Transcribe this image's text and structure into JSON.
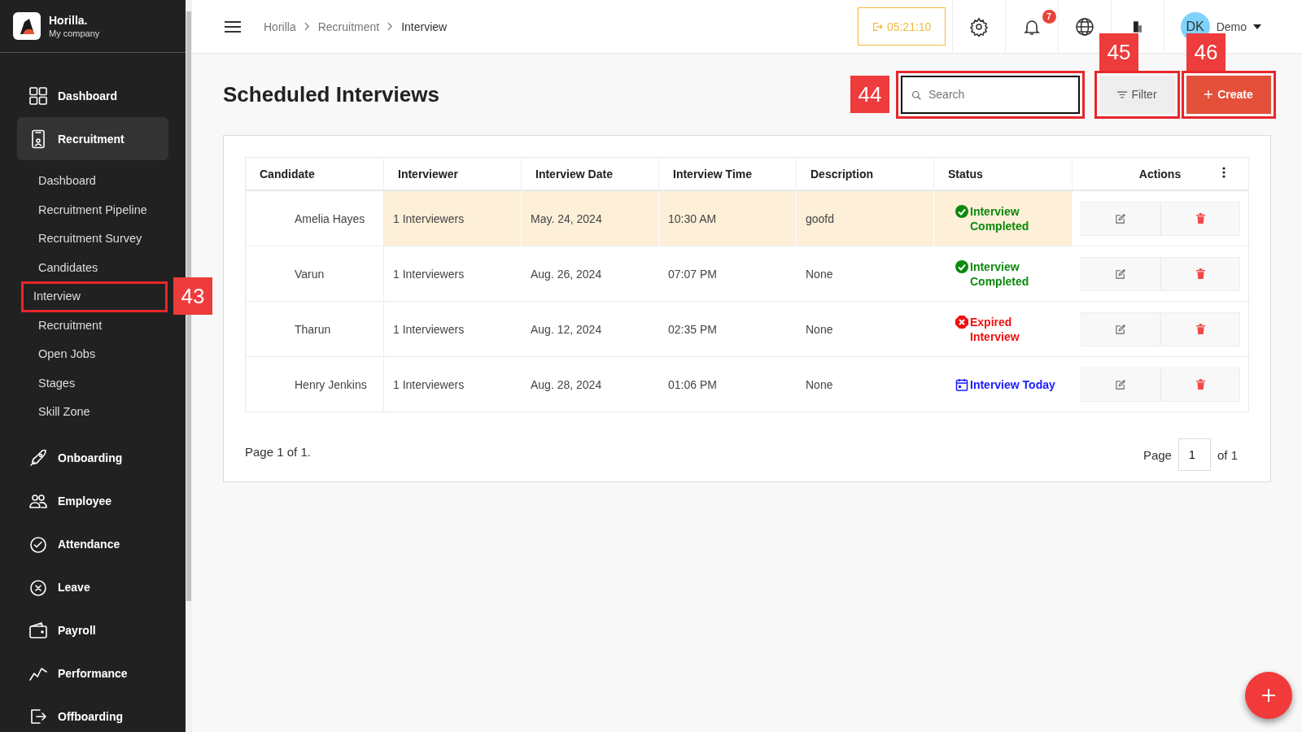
{
  "brand": {
    "name": "Horilla.",
    "company": "My company"
  },
  "sidebar": {
    "items": [
      {
        "label": "Dashboard",
        "selected": false
      },
      {
        "label": "Recruitment",
        "selected": true,
        "children": [
          {
            "label": "Dashboard"
          },
          {
            "label": "Recruitment Pipeline"
          },
          {
            "label": "Recruitment Survey"
          },
          {
            "label": "Candidates"
          },
          {
            "label": "Interview",
            "annotation": "43"
          },
          {
            "label": "Recruitment"
          },
          {
            "label": "Open Jobs"
          },
          {
            "label": "Stages"
          },
          {
            "label": "Skill Zone"
          }
        ]
      },
      {
        "label": "Onboarding",
        "selected": false
      },
      {
        "label": "Employee",
        "selected": false
      },
      {
        "label": "Attendance",
        "selected": false
      },
      {
        "label": "Leave",
        "selected": false
      },
      {
        "label": "Payroll",
        "selected": false
      },
      {
        "label": "Performance",
        "selected": false
      },
      {
        "label": "Offboarding",
        "selected": false
      }
    ]
  },
  "topbar": {
    "breadcrumbs": [
      "Horilla",
      "Recruitment",
      "Interview"
    ],
    "timer": "05:21:10",
    "notification_count": "7",
    "user": {
      "initials": "DK",
      "name": "Demo"
    }
  },
  "page": {
    "title": "Scheduled Interviews",
    "search": {
      "placeholder": "Search",
      "annotation": "44"
    },
    "filter_button": {
      "label": "Filter",
      "annotation": "45"
    },
    "create_button": {
      "label": "Create",
      "annotation": "46"
    }
  },
  "table": {
    "columns": [
      "Candidate",
      "Interviewer",
      "Interview Date",
      "Interview Time",
      "Description",
      "Status",
      "Actions"
    ],
    "rows": [
      {
        "candidate": "Amelia Hayes",
        "interviewer": "1 Interviewers",
        "date": "May. 24, 2024",
        "time": "10:30 AM",
        "description": "goofd",
        "status": {
          "kind": "completed",
          "lines": [
            "Interview",
            "Completed"
          ]
        },
        "highlighted": true
      },
      {
        "candidate": "Varun",
        "interviewer": "1 Interviewers",
        "date": "Aug. 26, 2024",
        "time": "07:07 PM",
        "description": "None",
        "status": {
          "kind": "completed",
          "lines": [
            "Interview",
            "Completed"
          ]
        },
        "highlighted": false
      },
      {
        "candidate": "Tharun",
        "interviewer": "1 Interviewers",
        "date": "Aug. 12, 2024",
        "time": "02:35 PM",
        "description": "None",
        "status": {
          "kind": "expired",
          "lines": [
            "Expired",
            "Interview"
          ]
        },
        "highlighted": false
      },
      {
        "candidate": "Henry Jenkins",
        "interviewer": "1 Interviewers",
        "date": "Aug. 28, 2024",
        "time": "01:06 PM",
        "description": "None",
        "status": {
          "kind": "today",
          "lines": [
            "Interview Today"
          ]
        },
        "highlighted": false
      }
    ]
  },
  "pagination": {
    "summary": "Page 1 of 1.",
    "page_label": "Page",
    "page_value": "1",
    "of_label": "of 1"
  }
}
